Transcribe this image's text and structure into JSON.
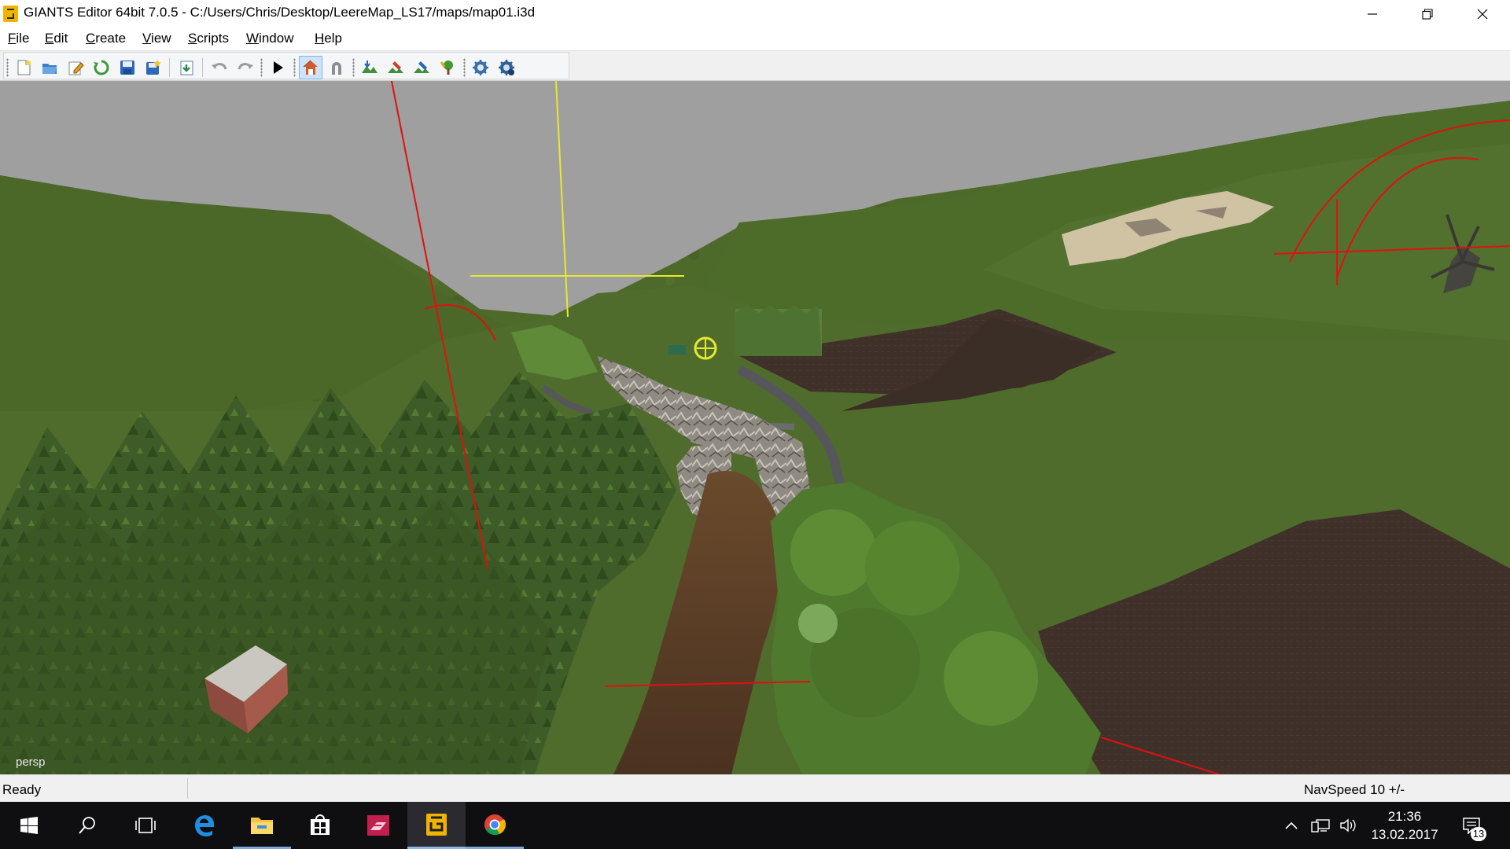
{
  "window": {
    "title": "GIANTS Editor 64bit 7.0.5 - C:/Users/Chris/Desktop/LeereMap_LS17/maps/map01.i3d",
    "app_icon": "giants-editor-icon",
    "controls": [
      "minimize-icon",
      "maximize-icon",
      "close-icon"
    ]
  },
  "menu": {
    "items": [
      "File",
      "Edit",
      "Create",
      "View",
      "Scripts",
      "Window",
      "Help"
    ]
  },
  "toolbar": {
    "groups": [
      [
        "new-file-icon",
        "open-file-icon",
        "edit-file-icon",
        "reload-icon",
        "save-icon",
        "save-as-icon"
      ],
      [
        "import-icon"
      ],
      [
        "undo-icon",
        "redo-icon"
      ],
      [
        "play-icon"
      ],
      [
        "home-view-icon",
        "magnet-icon"
      ],
      [
        "terrain-sculpt-icon",
        "terrain-paint-icon",
        "foliage-paint-icon",
        "tree-paint-icon"
      ],
      [
        "scene-settings-icon",
        "object-settings-icon"
      ]
    ],
    "active": "home-view-icon"
  },
  "viewport": {
    "camera_label": "persp"
  },
  "statusbar": {
    "left": "Ready",
    "right": "NavSpeed 10 +/-"
  },
  "taskbar": {
    "apps": [
      "windows-start-icon",
      "search-icon",
      "task-view-icon",
      "edge-browser-icon",
      "file-explorer-icon",
      "store-icon",
      "forza-app-icon",
      "giants-editor-icon",
      "chrome-icon"
    ],
    "running": [
      "file-explorer-icon",
      "giants-editor-icon",
      "chrome-icon"
    ],
    "active_app": "giants-editor-icon",
    "time": "21:36",
    "date": "13.02.2017",
    "notifications": "13"
  },
  "colors": {
    "sky": "#9f9f9f",
    "grass": "#4f6a2a",
    "forest": "#3d5a26",
    "field": "#3e3128",
    "selection_yellow": "#e8e830",
    "gizmo_red": "#e01010",
    "taskbar": "#0f0f12"
  }
}
